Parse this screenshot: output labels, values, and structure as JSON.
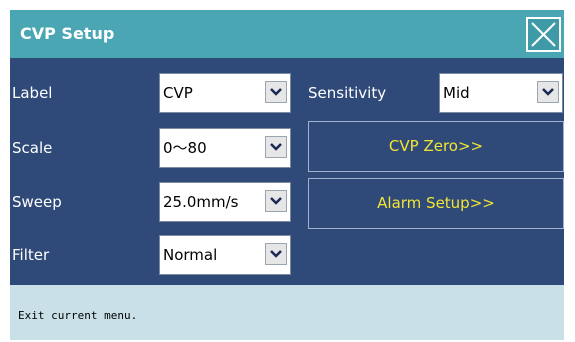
{
  "window": {
    "title": "CVP Setup",
    "close_icon": "close-x-icon"
  },
  "fields": {
    "label": {
      "label": "Label",
      "value": "CVP"
    },
    "scale": {
      "label": "Scale",
      "value": "0～80"
    },
    "sweep": {
      "label": "Sweep",
      "value": "25.0mm/s"
    },
    "filter": {
      "label": "Filter",
      "value": "Normal"
    },
    "sensitivity": {
      "label": "Sensitivity",
      "value": "Mid"
    }
  },
  "buttons": {
    "cvp_zero": "CVP Zero>>",
    "alarm_setup": "Alarm Setup>>"
  },
  "status": {
    "message": "Exit current menu."
  },
  "colors": {
    "titlebar": "#4aa6b3",
    "panel": "#2f4a78",
    "button_text": "#f2e533",
    "status_bar": "#c9e0e9"
  }
}
